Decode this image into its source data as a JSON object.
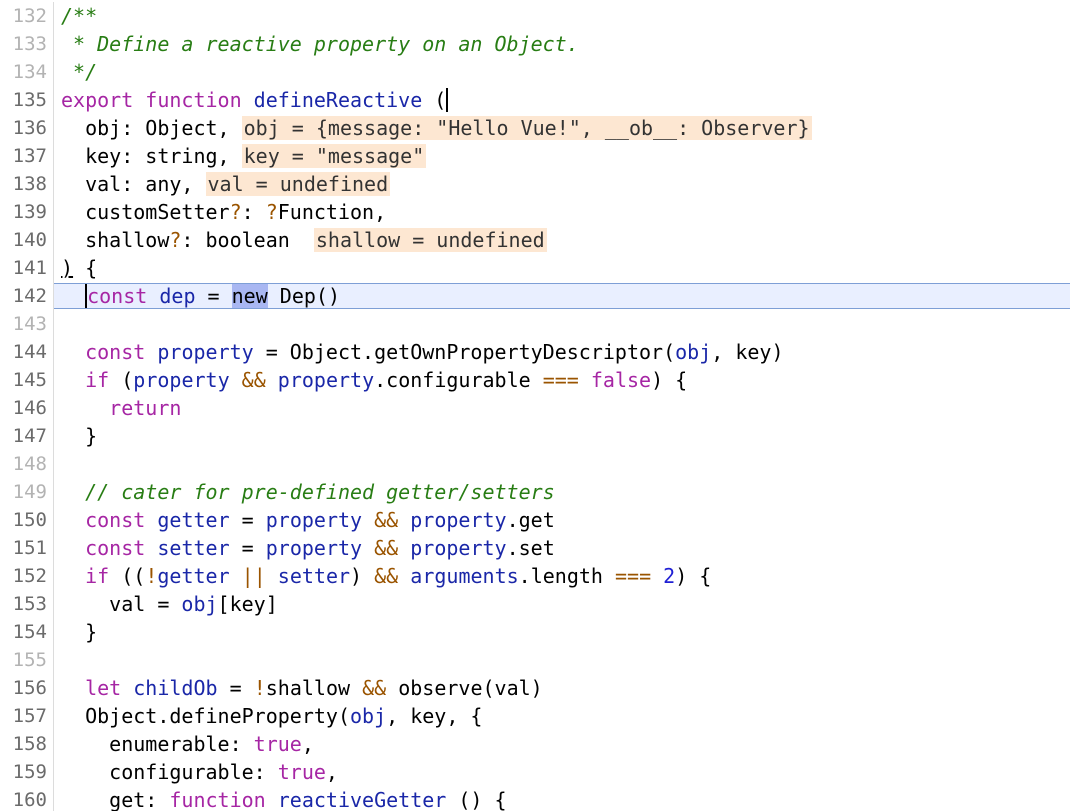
{
  "editor": {
    "current_line": 142,
    "lines": [
      {
        "n": 132,
        "dim": true,
        "tokens": [
          {
            "t": "/**",
            "c": "cmt"
          }
        ]
      },
      {
        "n": 133,
        "dim": true,
        "tokens": [
          {
            "t": " * Define a reactive property on an Object.",
            "c": "cmt"
          }
        ]
      },
      {
        "n": 134,
        "dim": true,
        "tokens": [
          {
            "t": " */",
            "c": "cmt"
          }
        ]
      },
      {
        "n": 135,
        "dim": false,
        "tokens": [
          {
            "t": "export",
            "c": "kw"
          },
          {
            "t": " "
          },
          {
            "t": "function",
            "c": "kw"
          },
          {
            "t": " "
          },
          {
            "t": "defineReactive",
            "c": "fn"
          },
          {
            "t": " ("
          },
          {
            "t": "",
            "c": "caret"
          }
        ]
      },
      {
        "n": 136,
        "dim": false,
        "tokens": [
          {
            "t": "  obj: Object, "
          },
          {
            "t": "obj = {message: \"Hello Vue!\", __ob__: Observer}",
            "c": "inl"
          }
        ]
      },
      {
        "n": 137,
        "dim": false,
        "tokens": [
          {
            "t": "  key: string, "
          },
          {
            "t": "key = \"message\"",
            "c": "inl"
          }
        ]
      },
      {
        "n": 138,
        "dim": false,
        "tokens": [
          {
            "t": "  val: any, "
          },
          {
            "t": "val = undefined",
            "c": "inl"
          }
        ]
      },
      {
        "n": 139,
        "dim": false,
        "tokens": [
          {
            "t": "  customSetter"
          },
          {
            "t": "?",
            "c": "op"
          },
          {
            "t": ": "
          },
          {
            "t": "?",
            "c": "op"
          },
          {
            "t": "Function,"
          }
        ]
      },
      {
        "n": 140,
        "dim": false,
        "tokens": [
          {
            "t": "  shallow"
          },
          {
            "t": "?",
            "c": "op"
          },
          {
            "t": ": boolean  "
          },
          {
            "t": "shallow = undefined",
            "c": "inl"
          }
        ]
      },
      {
        "n": 141,
        "dim": false,
        "tokens": [
          {
            "t": ")",
            "c": "ul"
          },
          {
            "t": " {"
          }
        ]
      },
      {
        "n": 142,
        "dim": false,
        "tokens": [
          {
            "t": "  "
          },
          {
            "t": "",
            "c": "caret"
          },
          {
            "t": "const",
            "c": "kw"
          },
          {
            "t": " "
          },
          {
            "t": "dep",
            "c": "var"
          },
          {
            "t": " = "
          },
          {
            "t": "new",
            "c": "sel"
          },
          {
            "t": " Dep()"
          }
        ]
      },
      {
        "n": 143,
        "dim": true,
        "tokens": []
      },
      {
        "n": 144,
        "dim": false,
        "tokens": [
          {
            "t": "  "
          },
          {
            "t": "const",
            "c": "kw"
          },
          {
            "t": " "
          },
          {
            "t": "property",
            "c": "var"
          },
          {
            "t": " = Object.getOwnPropertyDescriptor("
          },
          {
            "t": "obj",
            "c": "var"
          },
          {
            "t": ", key)"
          }
        ]
      },
      {
        "n": 145,
        "dim": false,
        "tokens": [
          {
            "t": "  "
          },
          {
            "t": "if",
            "c": "kw"
          },
          {
            "t": " ("
          },
          {
            "t": "property",
            "c": "var"
          },
          {
            "t": " "
          },
          {
            "t": "&&",
            "c": "op"
          },
          {
            "t": " "
          },
          {
            "t": "property",
            "c": "var"
          },
          {
            "t": ".configurable "
          },
          {
            "t": "===",
            "c": "op"
          },
          {
            "t": " "
          },
          {
            "t": "false",
            "c": "lit"
          },
          {
            "t": ") {"
          }
        ]
      },
      {
        "n": 146,
        "dim": false,
        "tokens": [
          {
            "t": "    "
          },
          {
            "t": "return",
            "c": "kw"
          }
        ]
      },
      {
        "n": 147,
        "dim": false,
        "tokens": [
          {
            "t": "  }"
          }
        ]
      },
      {
        "n": 148,
        "dim": true,
        "tokens": []
      },
      {
        "n": 149,
        "dim": true,
        "tokens": [
          {
            "t": "  "
          },
          {
            "t": "// cater for pre-defined getter/setters",
            "c": "cmt"
          }
        ]
      },
      {
        "n": 150,
        "dim": false,
        "tokens": [
          {
            "t": "  "
          },
          {
            "t": "const",
            "c": "kw"
          },
          {
            "t": " "
          },
          {
            "t": "getter",
            "c": "var"
          },
          {
            "t": " = "
          },
          {
            "t": "property",
            "c": "var"
          },
          {
            "t": " "
          },
          {
            "t": "&&",
            "c": "op"
          },
          {
            "t": " "
          },
          {
            "t": "property",
            "c": "var"
          },
          {
            "t": ".get"
          }
        ]
      },
      {
        "n": 151,
        "dim": false,
        "tokens": [
          {
            "t": "  "
          },
          {
            "t": "const",
            "c": "kw"
          },
          {
            "t": " "
          },
          {
            "t": "setter",
            "c": "var"
          },
          {
            "t": " = "
          },
          {
            "t": "property",
            "c": "var"
          },
          {
            "t": " "
          },
          {
            "t": "&&",
            "c": "op"
          },
          {
            "t": " "
          },
          {
            "t": "property",
            "c": "var"
          },
          {
            "t": ".set"
          }
        ]
      },
      {
        "n": 152,
        "dim": false,
        "tokens": [
          {
            "t": "  "
          },
          {
            "t": "if",
            "c": "kw"
          },
          {
            "t": " (("
          },
          {
            "t": "!",
            "c": "op"
          },
          {
            "t": "getter",
            "c": "var"
          },
          {
            "t": " "
          },
          {
            "t": "||",
            "c": "op"
          },
          {
            "t": " "
          },
          {
            "t": "setter",
            "c": "var"
          },
          {
            "t": ") "
          },
          {
            "t": "&&",
            "c": "op"
          },
          {
            "t": " "
          },
          {
            "t": "arguments",
            "c": "var"
          },
          {
            "t": ".length "
          },
          {
            "t": "===",
            "c": "op"
          },
          {
            "t": " "
          },
          {
            "t": "2",
            "c": "num"
          },
          {
            "t": ") {"
          }
        ]
      },
      {
        "n": 153,
        "dim": false,
        "tokens": [
          {
            "t": "    val = "
          },
          {
            "t": "obj",
            "c": "var"
          },
          {
            "t": "[key]"
          }
        ]
      },
      {
        "n": 154,
        "dim": false,
        "tokens": [
          {
            "t": "  }"
          }
        ]
      },
      {
        "n": 155,
        "dim": true,
        "tokens": []
      },
      {
        "n": 156,
        "dim": false,
        "tokens": [
          {
            "t": "  "
          },
          {
            "t": "let",
            "c": "kw"
          },
          {
            "t": " "
          },
          {
            "t": "childOb",
            "c": "var"
          },
          {
            "t": " = "
          },
          {
            "t": "!",
            "c": "op"
          },
          {
            "t": "shallow "
          },
          {
            "t": "&&",
            "c": "op"
          },
          {
            "t": " observe(val)"
          }
        ]
      },
      {
        "n": 157,
        "dim": false,
        "tokens": [
          {
            "t": "  Object.defineProperty("
          },
          {
            "t": "obj",
            "c": "var"
          },
          {
            "t": ", key, {"
          }
        ]
      },
      {
        "n": 158,
        "dim": false,
        "tokens": [
          {
            "t": "    enumerable: "
          },
          {
            "t": "true",
            "c": "lit"
          },
          {
            "t": ","
          }
        ]
      },
      {
        "n": 159,
        "dim": false,
        "tokens": [
          {
            "t": "    configurable: "
          },
          {
            "t": "true",
            "c": "lit"
          },
          {
            "t": ","
          }
        ]
      },
      {
        "n": 160,
        "dim": false,
        "tokens": [
          {
            "t": "    get: "
          },
          {
            "t": "function",
            "c": "kw"
          },
          {
            "t": " "
          },
          {
            "t": "reactiveGetter",
            "c": "fn"
          },
          {
            "t": " () {"
          }
        ]
      }
    ]
  }
}
